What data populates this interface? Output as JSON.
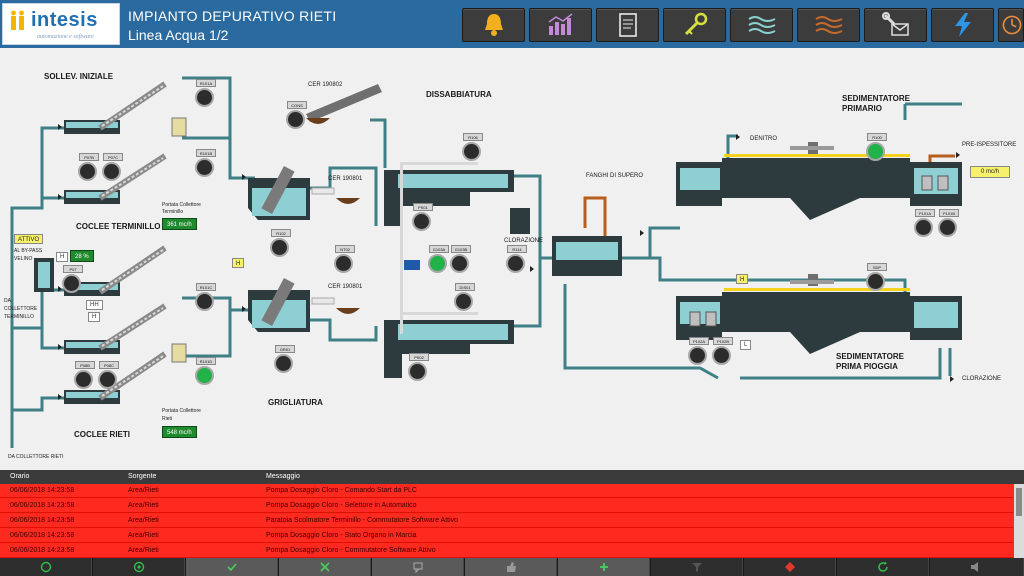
{
  "header": {
    "logo_text": "intesis",
    "logo_tagline": "automazione e software",
    "title": "IMPIANTO DEPURATIVO RIETI",
    "subtitle": "Linea Acqua 1/2",
    "buttons": [
      {
        "name": "alarm-bell-button",
        "icon": "bell-icon"
      },
      {
        "name": "trends-button",
        "icon": "bar-chart-icon"
      },
      {
        "name": "reports-button",
        "icon": "document-icon"
      },
      {
        "name": "login-key-button",
        "icon": "key-icon"
      },
      {
        "name": "water-line-button",
        "icon": "waves-icon"
      },
      {
        "name": "sludge-line-button",
        "icon": "waves-icon"
      },
      {
        "name": "maintenance-mail-button",
        "icon": "wrench-mail-icon"
      },
      {
        "name": "energy-button",
        "icon": "lightning-icon"
      },
      {
        "name": "scheduler-button",
        "icon": "clock-icon"
      },
      {
        "name": "home-button",
        "icon": "home-icon"
      }
    ]
  },
  "synoptic": {
    "sollev_iniziale": "SOLLEV. INIZIALE",
    "coclee_terminillo": "COCLEE TERMINILLO",
    "coclee_rieti": "COCLEE RIETI",
    "dissabbiatura": "DISSABBIATURA",
    "grigliatura": "GRIGLIATURA",
    "sedimentatore_primario_1": "SEDIMENTATORE",
    "sedimentatore_primario_2": "PRIMARIO",
    "sedimentatore_pioggia_1": "SEDIMENTATORE",
    "sedimentatore_pioggia_2": "PRIMA PIOGGIA",
    "fanghi_supero": "FANGHI DI SUPERO",
    "clorazione_1": "CLORAZIONE",
    "clorazione_2": "CLORAZIONE",
    "denitro": "DENITRO",
    "pre_ispessitore": "PRE-ISPESSITORE",
    "pre_ispessitore_value": "0 mc/h",
    "cer_top": "CER 190802",
    "cer_mid1": "CER 190801",
    "cer_mid2": "CER 190801",
    "portata_terminillo_1": "Portata Collettore",
    "portata_terminillo_2": "Terminillo",
    "portata_terminillo_value": "361 mc/h",
    "portata_rieti_1": "Portata Collettore",
    "portata_rieti_2": "Rieti",
    "portata_rieti_value": "548 mc/h",
    "attivo": "ATTIVO",
    "bypass_1": "AL BY-PASS",
    "bypass_2": "VELINO",
    "bypass_value": "28 %",
    "da_collettore_1": "DA",
    "da_collettore_2": "COLLETTORE",
    "da_collettore_3": "TERMINILLO",
    "da_collettore_rieti": "DA COLLETTORE RIETI",
    "level_h1": "H",
    "level_h2": "H",
    "level_h3": "H",
    "level_hh": "HH",
    "level_h4": "H",
    "level_l": "L",
    "pumps": {
      "r101a": "R101A",
      "r101b": "R101B",
      "r101c": "R101C",
      "r101d": "R101D",
      "p07b": "P07B",
      "p07c": "P07C",
      "p07": "P07",
      "p08b": "P08B",
      "p08c": "P08C",
      "cons": "CONS",
      "r102": "R102",
      "gr01": "GR01",
      "nt02": "NT02",
      "r106": "R106",
      "pso1": "PS01",
      "pso2": "PS02",
      "g103a": "G103A",
      "g103b": "G103B",
      "dis01": "DIS01",
      "r114": "R114",
      "r100": "R100",
      "p101a": "P101A",
      "p101b": "P101B",
      "sdp": "SDP",
      "p102a": "P102A",
      "p102b": "P102B"
    }
  },
  "alarms": {
    "columns": {
      "orario": "Orario",
      "sorgente": "Sorgente",
      "messaggio": "Messaggio"
    },
    "rows": [
      {
        "orario": "06/06/2018 14:23:58",
        "sorgente": "Area/Rieti",
        "messaggio": "Pompa Dosaggio Cloro  - Comando Start da PLC"
      },
      {
        "orario": "06/06/2018 14:23:58",
        "sorgente": "Area/Rieti",
        "messaggio": "Pompa Dosaggio Cloro  - Selettore in Automatico"
      },
      {
        "orario": "06/06/2018 14:23:58",
        "sorgente": "Area/Rieti",
        "messaggio": "Paratoia Scolmatore Terminillo - Commutatore Software Attivo"
      },
      {
        "orario": "06/06/2018 14:23:58",
        "sorgente": "Area/Rieti",
        "messaggio": "Pompa Dosaggio Cloro  - Stato Organo in Marcia"
      },
      {
        "orario": "06/06/2018 14:23:58",
        "sorgente": "Area/Rieti",
        "messaggio": "Pompa Dosaggio Cloro  - Commutatore Software Attivo"
      }
    ]
  },
  "colors": {
    "header_bg": "#2a6a9e",
    "alarm_row": "#ff2a1f",
    "pipe": "#3f7f86",
    "tank_dark": "#2d3b3f",
    "water": "#8ecfd3",
    "indicator_green": "#21b24a"
  }
}
